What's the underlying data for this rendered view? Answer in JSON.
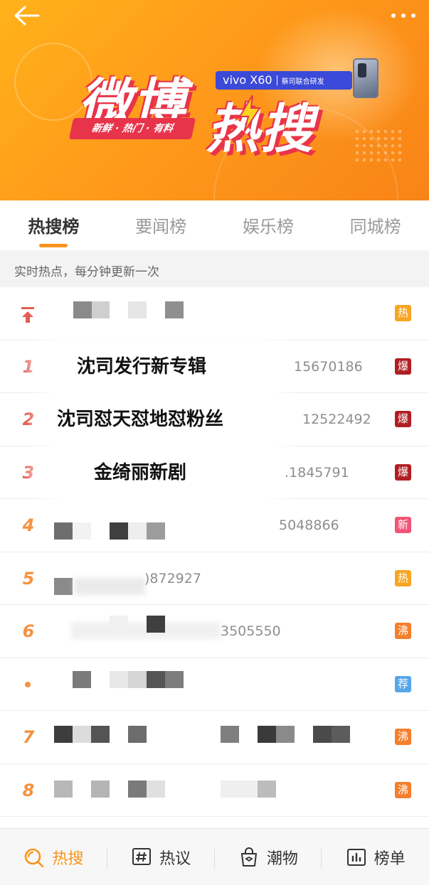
{
  "banner": {
    "logo_text_1": "微博",
    "logo_text_2": "热搜",
    "slogan": "新鲜 · 热门 · 有料",
    "sponsor_brand": "vivo X60",
    "sponsor_note": "蔡司联合研发"
  },
  "tabs": [
    {
      "label": "热搜榜",
      "active": true
    },
    {
      "label": "要闻榜",
      "active": false
    },
    {
      "label": "娱乐榜",
      "active": false
    },
    {
      "label": "同城榜",
      "active": false
    }
  ],
  "subtitle": "实时热点，每分钟更新一次",
  "list": [
    {
      "rank": "",
      "title": "",
      "count": "",
      "badge": "热",
      "badge_color": "#f7a522"
    },
    {
      "rank": "1",
      "title": "沈司发行新专辑",
      "count": "15670186",
      "badge": "爆",
      "badge_color": "#b01e23"
    },
    {
      "rank": "2",
      "title": "沈司怼天怼地怼粉丝",
      "count": "12522492",
      "badge": "爆",
      "badge_color": "#b01e23"
    },
    {
      "rank": "3",
      "title": "金绮丽新剧",
      "count": ".1845791",
      "badge": "爆",
      "badge_color": "#b01e23"
    },
    {
      "rank": "4",
      "title": "",
      "count": "5048866",
      "badge": "新",
      "badge_color": "#f25478"
    },
    {
      "rank": "5",
      "title": "",
      "count": ")872927",
      "badge": "热",
      "badge_color": "#f7a522"
    },
    {
      "rank": "6",
      "title": "",
      "count": "3505550",
      "badge": "沸",
      "badge_color": "#f47f2c"
    },
    {
      "rank": "•",
      "title": "",
      "count": "",
      "badge": "荐",
      "badge_color": "#58a6ea"
    },
    {
      "rank": "7",
      "title": "",
      "count": "",
      "badge": "沸",
      "badge_color": "#f47f2c"
    },
    {
      "rank": "8",
      "title": "",
      "count": "",
      "badge": "沸",
      "badge_color": "#f47f2c"
    }
  ],
  "bottom_nav": [
    {
      "label": "热搜",
      "icon": "search-icon",
      "active": true
    },
    {
      "label": "热议",
      "icon": "hashtag-icon",
      "active": false
    },
    {
      "label": "潮物",
      "icon": "shopping-bag-icon",
      "active": false
    },
    {
      "label": "榜单",
      "icon": "chart-icon",
      "active": false
    }
  ],
  "colors": {
    "accent": "#f7941d",
    "rank_top": "#e35d52",
    "rank_mid": "#f5923e"
  }
}
